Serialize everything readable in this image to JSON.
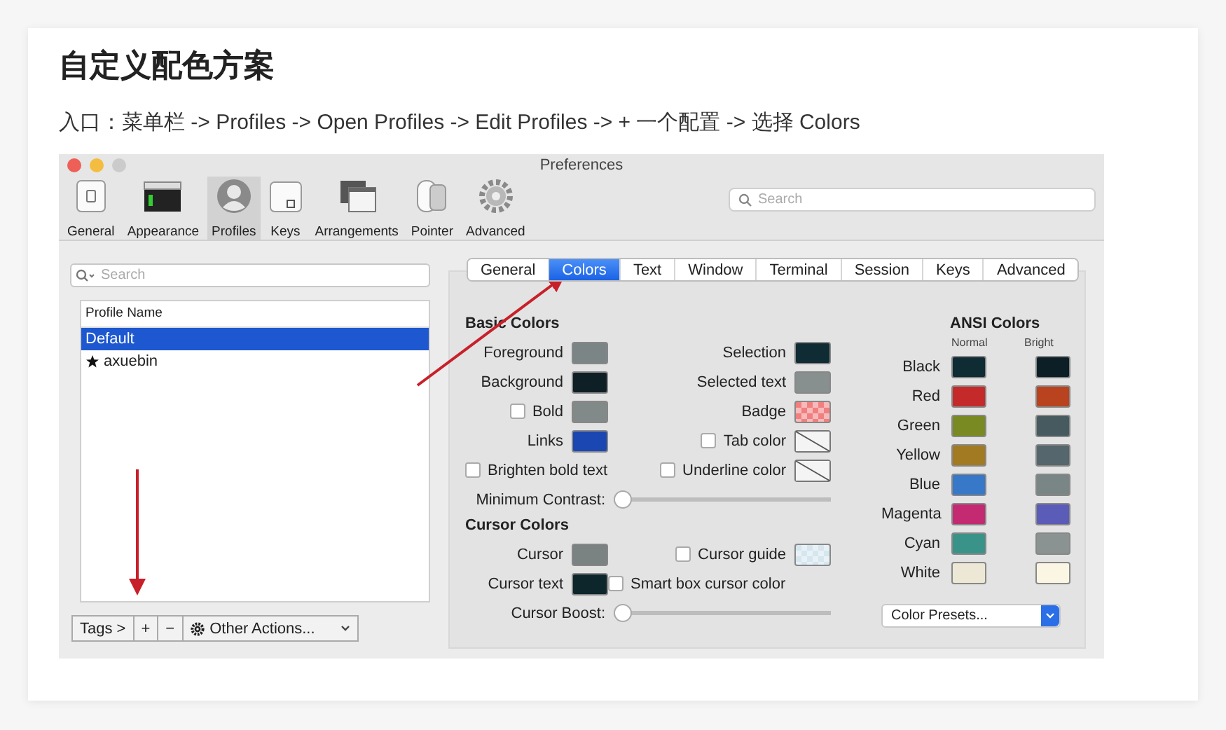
{
  "heading": "自定义配色方案",
  "intro": "入口：菜单栏 -> Profiles -> Open Profiles -> Edit Profiles -> + 一个配置 -> 选择 Colors",
  "window": {
    "title": "Preferences",
    "search": {
      "placeholder": "Search"
    },
    "toolbar": [
      {
        "kind": "general",
        "label": "General",
        "selected": false
      },
      {
        "kind": "appearance",
        "label": "Appearance",
        "selected": false
      },
      {
        "kind": "profiles",
        "label": "Profiles",
        "selected": true
      },
      {
        "kind": "keys",
        "label": "Keys",
        "selected": false
      },
      {
        "kind": "arrangements",
        "label": "Arrangements",
        "selected": false
      },
      {
        "kind": "pointer",
        "label": "Pointer",
        "selected": false
      },
      {
        "kind": "advanced",
        "label": "Advanced",
        "selected": false
      }
    ]
  },
  "profiles": {
    "search": {
      "placeholder": "Search"
    },
    "column": "Profile Name",
    "rows": [
      {
        "name": "Default",
        "selected": true,
        "starred": false
      },
      {
        "name": "axuebin",
        "selected": false,
        "starred": true
      }
    ],
    "footer": {
      "tags": "Tags >",
      "add": "+",
      "remove": "−",
      "actions": "Other Actions..."
    }
  },
  "tabs": [
    {
      "label": "General",
      "selected": false
    },
    {
      "label": "Colors",
      "selected": true
    },
    {
      "label": "Text",
      "selected": false
    },
    {
      "label": "Window",
      "selected": false
    },
    {
      "label": "Terminal",
      "selected": false
    },
    {
      "label": "Session",
      "selected": false
    },
    {
      "label": "Keys",
      "selected": false
    },
    {
      "label": "Advanced",
      "selected": false
    }
  ],
  "basic_colors": {
    "title": "Basic Colors",
    "rows": [
      [
        {
          "kind": "swatch",
          "label": "Foreground",
          "color": "#7c8585"
        },
        {
          "kind": "swatch",
          "label": "Selection",
          "color": "#0f2b33"
        }
      ],
      [
        {
          "kind": "swatch",
          "label": "Background",
          "color": "#0f1f26"
        },
        {
          "kind": "swatch",
          "label": "Selected text",
          "color": "#878f8f"
        }
      ],
      [
        {
          "kind": "check-swatch",
          "label": "Bold",
          "checked": false,
          "color": "#828a89"
        },
        {
          "kind": "pattern-swatch",
          "label": "Badge",
          "color": "#f08080"
        }
      ],
      [
        {
          "kind": "swatch",
          "label": "Links",
          "color": "#1b47b3"
        },
        {
          "kind": "check-empty-swatch",
          "label": "Tab color",
          "checked": false
        }
      ],
      [
        {
          "kind": "check",
          "label": "Brighten bold text",
          "checked": false
        },
        {
          "kind": "check-empty-swatch",
          "label": "Underline color",
          "checked": false
        }
      ],
      [
        {
          "kind": "slider",
          "label": "Minimum Contrast:",
          "level": 0
        }
      ]
    ]
  },
  "cursor_colors": {
    "title": "Cursor Colors",
    "rows": [
      [
        {
          "kind": "swatch",
          "label": "Cursor",
          "color": "#7a8282"
        },
        {
          "kind": "check-pattern-swatch",
          "label": "Cursor guide",
          "checked": false,
          "color": "#d6e6ee"
        }
      ],
      [
        {
          "kind": "swatch",
          "label": "Cursor text",
          "color": "#0c262b"
        },
        {
          "kind": "check",
          "label": "Smart box cursor color",
          "checked": false
        }
      ],
      [
        {
          "kind": "slider",
          "label": "Cursor Boost:",
          "level": 0
        }
      ]
    ]
  },
  "ansi_colors": {
    "title": "ANSI Colors",
    "columns": [
      "Normal",
      "Bright"
    ],
    "rows": [
      {
        "name": "Black",
        "swatches": [
          {
            "color": "#0f2b33"
          },
          {
            "color": "#0c1f26"
          }
        ]
      },
      {
        "name": "Red",
        "swatches": [
          {
            "color": "#c52a2a"
          },
          {
            "color": "#b8431e"
          }
        ]
      },
      {
        "name": "Green",
        "swatches": [
          {
            "color": "#7a8a22"
          },
          {
            "color": "#475a60"
          }
        ]
      },
      {
        "name": "Yellow",
        "swatches": [
          {
            "color": "#a27a22"
          },
          {
            "color": "#55666c"
          }
        ]
      },
      {
        "name": "Blue",
        "swatches": [
          {
            "color": "#3778c8"
          },
          {
            "color": "#7a8585"
          }
        ]
      },
      {
        "name": "Magenta",
        "swatches": [
          {
            "color": "#c32a72"
          },
          {
            "color": "#5a5cb8"
          }
        ]
      },
      {
        "name": "Cyan",
        "swatches": [
          {
            "color": "#3a9388"
          },
          {
            "color": "#8a9391"
          }
        ]
      },
      {
        "name": "White",
        "swatches": [
          {
            "color": "#ece8d5"
          },
          {
            "color": "#faf6e3"
          }
        ]
      }
    ],
    "presets": "Color Presets..."
  }
}
